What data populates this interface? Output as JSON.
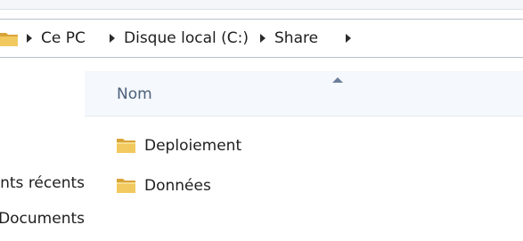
{
  "breadcrumb": {
    "items": [
      {
        "label": "Ce PC"
      },
      {
        "label": "Disque local (C:)"
      },
      {
        "label": "Share"
      }
    ]
  },
  "nav_pane": {
    "items": [
      {
        "label": "Emplacements récents"
      },
      {
        "label": "Documents"
      }
    ]
  },
  "file_list": {
    "column_header": "Nom",
    "items": [
      {
        "name": "Deploiement",
        "icon": "folder-icon"
      },
      {
        "name": "Données",
        "icon": "folder-icon"
      }
    ]
  },
  "colors": {
    "folder": "#e8b84a",
    "column_header_text": "#4c607a"
  }
}
